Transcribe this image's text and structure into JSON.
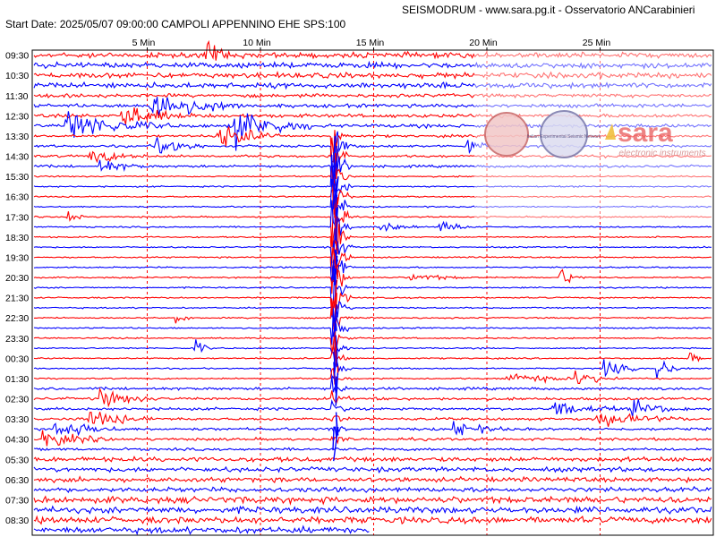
{
  "header": {
    "title": "SEISMODRUM - www.sara.pg.it - Osservatorio ANCarabinieri",
    "start_info": "Start Date: 2025/05/07 09:00:00 CAMPOLI APPENNINO   EHE  SPS:100"
  },
  "colors": {
    "trace_a": "#ff0000",
    "trace_b": "#0000ff",
    "grid": "#ff0000",
    "axis": "#000000"
  },
  "watermark": {
    "brand": "sara",
    "tagline": "electronic instruments",
    "seal_text": "Italian Experimental Seismic Network"
  },
  "chart_data": {
    "type": "line",
    "title": "",
    "xlabel": "",
    "ylabel": "",
    "x_unit": "minutes",
    "xlim": [
      0,
      30
    ],
    "x_ticks": [
      {
        "value": 5,
        "label": "5 Min"
      },
      {
        "value": 10,
        "label": "10 Min"
      },
      {
        "value": 15,
        "label": "15 Min"
      },
      {
        "value": 20,
        "label": "20 Min"
      },
      {
        "value": 25,
        "label": "25 Min"
      }
    ],
    "row_count": 48,
    "row_minutes": 30,
    "y_labels": [
      "09:30",
      "10:30",
      "11:30",
      "12:30",
      "13:30",
      "14:30",
      "15:30",
      "16:30",
      "17:30",
      "18:30",
      "19:30",
      "20:30",
      "21:30",
      "22:30",
      "23:30",
      "00:30",
      "01:30",
      "02:30",
      "03:30",
      "04:30",
      "05:30",
      "06:30",
      "07:30",
      "08:30"
    ],
    "last_row_end_minute": 14.8,
    "grid": true,
    "events": [
      {
        "row": 0,
        "minute": 7.7,
        "amp": 1.2,
        "len": 1.5
      },
      {
        "row": 5,
        "minute": 5.2,
        "amp": 2.0,
        "len": 4.0
      },
      {
        "row": 6,
        "minute": 4.0,
        "amp": 1.4,
        "len": 3.0
      },
      {
        "row": 7,
        "minute": 1.5,
        "amp": 1.8,
        "len": 4.5
      },
      {
        "row": 7,
        "minute": 9.0,
        "amp": 2.2,
        "len": 3.5
      },
      {
        "row": 8,
        "minute": 8.2,
        "amp": 1.6,
        "len": 3.0
      },
      {
        "row": 9,
        "minute": 5.5,
        "amp": 1.3,
        "len": 2.0
      },
      {
        "row": 9,
        "minute": 19.2,
        "amp": 1.2,
        "len": 1.0
      },
      {
        "row": 10,
        "minute": 2.5,
        "amp": 0.9,
        "len": 2.5
      },
      {
        "row": 11,
        "minute": 3.0,
        "amp": 0.8,
        "len": 2.0
      },
      {
        "row": 16,
        "minute": 1.6,
        "amp": 0.8,
        "len": 0.8
      },
      {
        "row": 17,
        "minute": 15.4,
        "amp": 0.9,
        "len": 1.6
      },
      {
        "row": 17,
        "minute": 18.0,
        "amp": 0.9,
        "len": 1.6
      },
      {
        "row": 22,
        "minute": 16.7,
        "amp": 0.6,
        "len": 2.5
      },
      {
        "row": 22,
        "minute": 23.3,
        "amp": 1.0,
        "len": 1.2
      },
      {
        "row": 26,
        "minute": 6.4,
        "amp": 0.9,
        "len": 0.6
      },
      {
        "row": 29,
        "minute": 7.2,
        "amp": 1.0,
        "len": 0.7
      },
      {
        "row": 30,
        "minute": 29.0,
        "amp": 0.8,
        "len": 0.6
      },
      {
        "row": 31,
        "minute": 25.3,
        "amp": 1.1,
        "len": 1.5
      },
      {
        "row": 31,
        "minute": 27.6,
        "amp": 1.1,
        "len": 1.5
      },
      {
        "row": 32,
        "minute": 20.8,
        "amp": 0.8,
        "len": 3.5
      },
      {
        "row": 32,
        "minute": 24.0,
        "amp": 0.9,
        "len": 2.0
      },
      {
        "row": 34,
        "minute": 3.0,
        "amp": 1.0,
        "len": 2.5
      },
      {
        "row": 35,
        "minute": 23.0,
        "amp": 0.9,
        "len": 3.0
      },
      {
        "row": 35,
        "minute": 26.5,
        "amp": 0.9,
        "len": 2.5
      },
      {
        "row": 36,
        "minute": 2.5,
        "amp": 1.0,
        "len": 3.0
      },
      {
        "row": 36,
        "minute": 25.0,
        "amp": 0.8,
        "len": 4.0
      },
      {
        "row": 37,
        "minute": 1.0,
        "amp": 1.2,
        "len": 3.0
      },
      {
        "row": 37,
        "minute": 18.5,
        "amp": 1.0,
        "len": 2.5
      },
      {
        "row": 38,
        "minute": 0.5,
        "amp": 1.0,
        "len": 3.0
      }
    ],
    "main_quake": {
      "row_start": 8,
      "row_end": 38,
      "minute": 13.2,
      "peak_row": 16
    }
  }
}
